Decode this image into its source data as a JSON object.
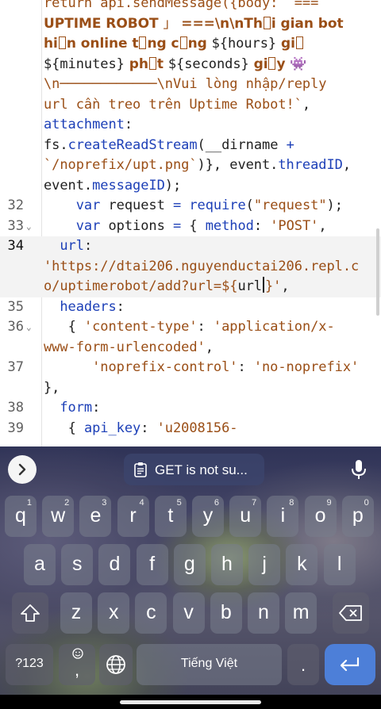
{
  "editor": {
    "lines": [
      {
        "num": "",
        "tokens": [
          {
            "t": "return api.sendMessage({body: `===",
            "c": "str"
          }
        ]
      },
      {
        "num": "",
        "tokens": [
          {
            "t": "UPTIME ROBOT ",
            "c": "strb"
          },
          {
            "t": "」",
            "c": "str"
          },
          {
            "t": " ===\\n\\nTh",
            "c": "strb"
          },
          {
            "t": "BOX",
            "c": "box"
          },
          {
            "t": "i gian bot",
            "c": "strb"
          }
        ]
      },
      {
        "num": "",
        "tokens": [
          {
            "t": "hi",
            "c": "strb"
          },
          {
            "t": "BOX",
            "c": "box"
          },
          {
            "t": "n online t",
            "c": "strb"
          },
          {
            "t": "BOX",
            "c": "box"
          },
          {
            "t": "ng c",
            "c": "strb"
          },
          {
            "t": "BOX",
            "c": "box"
          },
          {
            "t": "ng ",
            "c": "strb"
          },
          {
            "t": "${hours}",
            "c": "plain"
          },
          {
            "t": " gi",
            "c": "strb"
          },
          {
            "t": "BOX",
            "c": "box"
          }
        ]
      },
      {
        "num": "",
        "tokens": [
          {
            "t": "${minutes}",
            "c": "plain"
          },
          {
            "t": " ph",
            "c": "strb"
          },
          {
            "t": "BOX",
            "c": "box"
          },
          {
            "t": "t ",
            "c": "strb"
          },
          {
            "t": "${seconds}",
            "c": "plain"
          },
          {
            "t": " gi",
            "c": "strb"
          },
          {
            "t": "BOX",
            "c": "box"
          },
          {
            "t": "y ",
            "c": "strb"
          },
          {
            "t": "👾",
            "c": "str"
          }
        ]
      },
      {
        "num": "",
        "tokens": [
          {
            "t": "\\n────────────\\nVui lòng nhập/reply",
            "c": "str"
          }
        ]
      },
      {
        "num": "",
        "tokens": [
          {
            "t": "url cần treo trên Uptime Robot!`",
            "c": "str"
          },
          {
            "t": ",",
            "c": "plain"
          }
        ]
      },
      {
        "num": "",
        "tokens": [
          {
            "t": "attachment",
            "c": "prop"
          },
          {
            "t": ":",
            "c": "plain"
          }
        ]
      },
      {
        "num": "",
        "tokens": [
          {
            "t": "fs.",
            "c": "plain"
          },
          {
            "t": "createReadStream",
            "c": "fn"
          },
          {
            "t": "(__dirname ",
            "c": "plain"
          },
          {
            "t": "+",
            "c": "kw"
          }
        ]
      },
      {
        "num": "",
        "tokens": [
          {
            "t": "`/noprefix/upt.png`",
            "c": "str"
          },
          {
            "t": ")}, event.",
            "c": "plain"
          },
          {
            "t": "threadID",
            "c": "prop"
          },
          {
            "t": ",",
            "c": "plain"
          }
        ]
      },
      {
        "num": "",
        "tokens": [
          {
            "t": "event.",
            "c": "plain"
          },
          {
            "t": "messageID",
            "c": "prop"
          },
          {
            "t": ");",
            "c": "plain"
          }
        ]
      },
      {
        "num": "32",
        "tokens": [
          {
            "t": "    ",
            "c": "plain"
          },
          {
            "t": "var",
            "c": "kw"
          },
          {
            "t": " request ",
            "c": "plain"
          },
          {
            "t": "=",
            "c": "kw"
          },
          {
            "t": " ",
            "c": "plain"
          },
          {
            "t": "require",
            "c": "fn"
          },
          {
            "t": "(",
            "c": "plain"
          },
          {
            "t": "\"request\"",
            "c": "str"
          },
          {
            "t": ");",
            "c": "plain"
          }
        ]
      },
      {
        "num": "33",
        "fold": true,
        "tokens": [
          {
            "t": "    ",
            "c": "plain"
          },
          {
            "t": "var",
            "c": "kw"
          },
          {
            "t": " options ",
            "c": "plain"
          },
          {
            "t": "=",
            "c": "kw"
          },
          {
            "t": " { ",
            "c": "plain"
          },
          {
            "t": "method",
            "c": "prop"
          },
          {
            "t": ": ",
            "c": "plain"
          },
          {
            "t": "'POST'",
            "c": "str"
          },
          {
            "t": ",",
            "c": "plain"
          }
        ]
      },
      {
        "num": "34",
        "current": true,
        "tokens": [
          {
            "t": "  ",
            "c": "plain"
          },
          {
            "t": "url",
            "c": "prop"
          },
          {
            "t": ":",
            "c": "plain"
          }
        ]
      },
      {
        "num": "",
        "current": true,
        "tokens": [
          {
            "t": "'https://dtai206.nguyenductai206.repl.c",
            "c": "str"
          }
        ]
      },
      {
        "num": "",
        "current": true,
        "tokens": [
          {
            "t": "o/uptimerobot/add?url=${",
            "c": "str"
          },
          {
            "t": "url",
            "c": "plain"
          },
          {
            "t": "CURSOR",
            "c": "cursor"
          },
          {
            "t": "}'",
            "c": "str"
          },
          {
            "t": ",",
            "c": "plain"
          }
        ]
      },
      {
        "num": "35",
        "tokens": [
          {
            "t": "  ",
            "c": "plain"
          },
          {
            "t": "headers",
            "c": "prop"
          },
          {
            "t": ":",
            "c": "plain"
          }
        ]
      },
      {
        "num": "36",
        "fold": true,
        "tokens": [
          {
            "t": "   { ",
            "c": "plain"
          },
          {
            "t": "'content-type'",
            "c": "str"
          },
          {
            "t": ": ",
            "c": "plain"
          },
          {
            "t": "'application/x-",
            "c": "str"
          }
        ]
      },
      {
        "num": "",
        "tokens": [
          {
            "t": "www-form-urlencoded'",
            "c": "str"
          },
          {
            "t": ",",
            "c": "plain"
          }
        ]
      },
      {
        "num": "37",
        "tokens": [
          {
            "t": "      ",
            "c": "plain"
          },
          {
            "t": "'noprefix-control'",
            "c": "str"
          },
          {
            "t": ": ",
            "c": "plain"
          },
          {
            "t": "'no-noprefix'",
            "c": "str"
          }
        ]
      },
      {
        "num": "",
        "tokens": [
          {
            "t": "},",
            "c": "plain"
          }
        ]
      },
      {
        "num": "38",
        "tokens": [
          {
            "t": "  ",
            "c": "plain"
          },
          {
            "t": "form",
            "c": "prop"
          },
          {
            "t": ":",
            "c": "plain"
          }
        ]
      },
      {
        "num": "39",
        "tokens": [
          {
            "t": "   { ",
            "c": "plain"
          },
          {
            "t": "api_key",
            "c": "prop"
          },
          {
            "t": ": ",
            "c": "plain"
          },
          {
            "t": "'u2008156-",
            "c": "str"
          }
        ]
      }
    ]
  },
  "keyboard": {
    "suggestion": "GET is not su...",
    "row1": [
      {
        "ch": "q",
        "num": "1"
      },
      {
        "ch": "w",
        "num": "2"
      },
      {
        "ch": "e",
        "num": "3"
      },
      {
        "ch": "r",
        "num": "4"
      },
      {
        "ch": "t",
        "num": "5"
      },
      {
        "ch": "y",
        "num": "6"
      },
      {
        "ch": "u",
        "num": "7"
      },
      {
        "ch": "i",
        "num": "8"
      },
      {
        "ch": "o",
        "num": "9"
      },
      {
        "ch": "p",
        "num": "0"
      }
    ],
    "row2": [
      "a",
      "s",
      "d",
      "f",
      "g",
      "h",
      "j",
      "k",
      "l"
    ],
    "row3": [
      "z",
      "x",
      "c",
      "v",
      "b",
      "n",
      "m"
    ],
    "symbols_label": "?123",
    "comma": ",",
    "space_label": "Tiếng Việt",
    "period": "."
  },
  "colors": {
    "keyword": "#1c3fb7",
    "string": "#9a4e16",
    "enter": "#4d7fd8"
  },
  "icons": [
    "chevron-right-icon",
    "clipboard-icon",
    "mic-icon",
    "shift-icon",
    "backspace-icon",
    "emoji-icon",
    "globe-icon",
    "enter-icon"
  ]
}
